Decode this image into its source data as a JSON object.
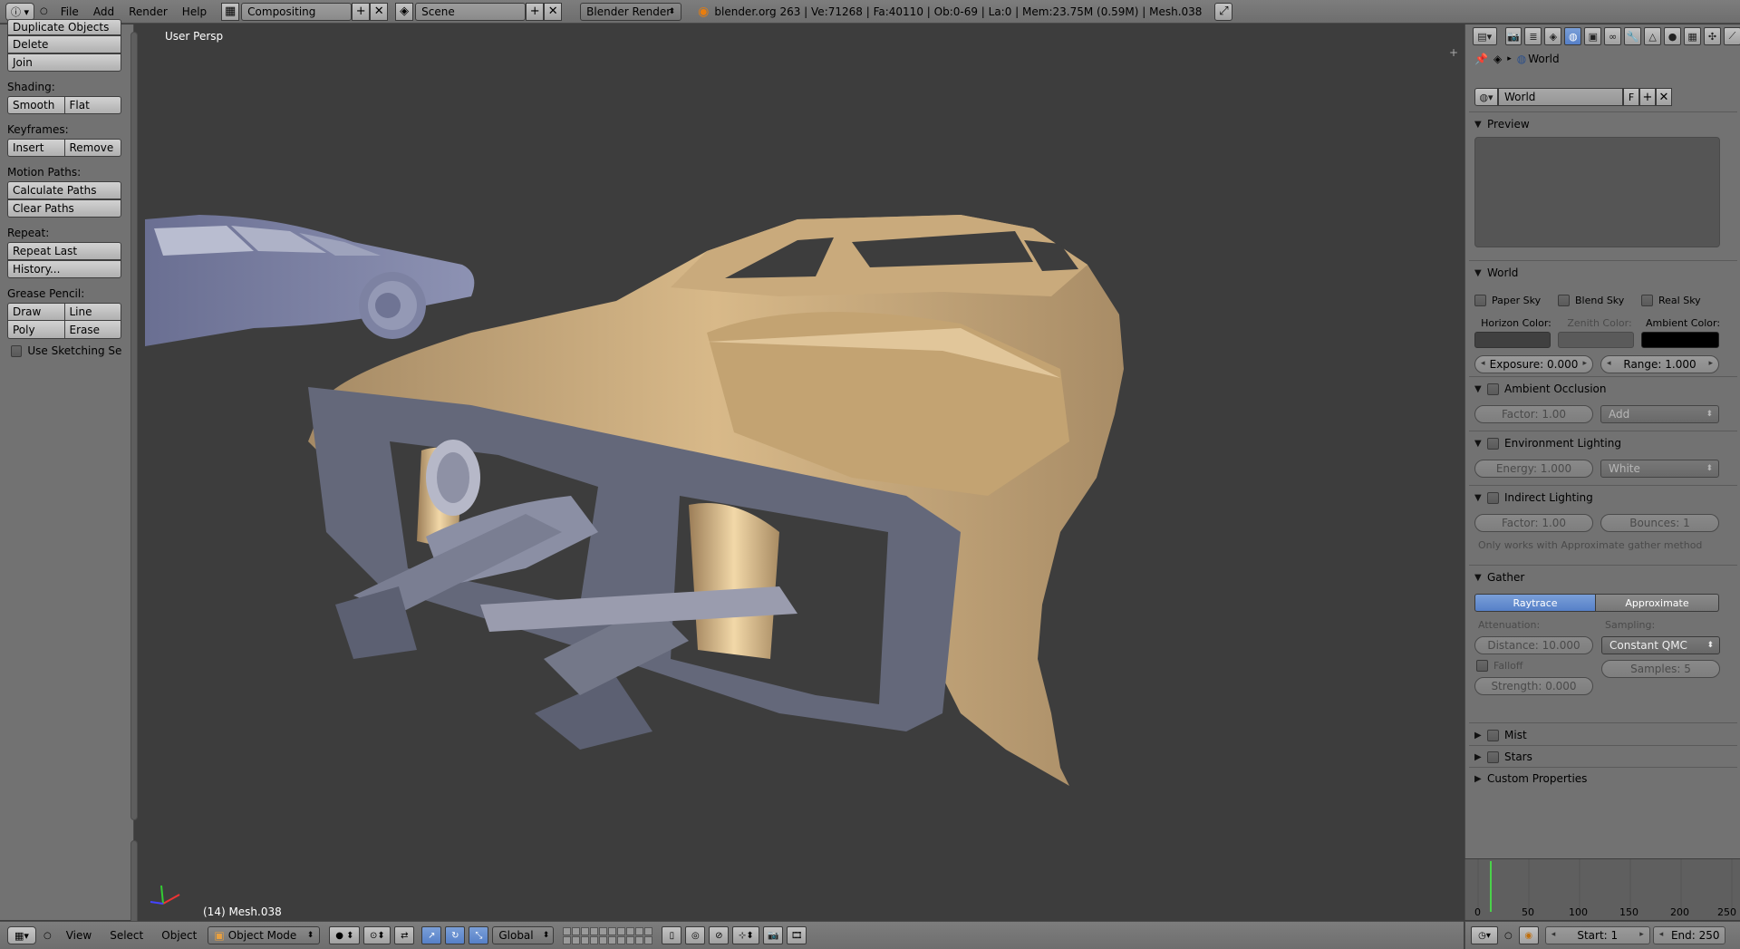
{
  "topbar": {
    "menus": [
      "File",
      "Add",
      "Render",
      "Help"
    ],
    "layout": "Compositing",
    "scene": "Scene",
    "engine": "Blender Render",
    "stats": "blender.org 263 | Ve:71268 | Fa:40110 | Ob:0-69 | La:0 | Mem:23.75M (0.59M) | Mesh.038"
  },
  "left_panel": {
    "dup_label": "Duplicate Objects",
    "delete": "Delete",
    "join": "Join",
    "shading_label": "Shading:",
    "smooth": "Smooth",
    "flat": "Flat",
    "keyframes_label": "Keyframes:",
    "insert": "Insert",
    "remove": "Remove",
    "motion_label": "Motion Paths:",
    "calc_paths": "Calculate Paths",
    "clear_paths": "Clear Paths",
    "repeat_label": "Repeat:",
    "repeat_last": "Repeat Last",
    "history": "History...",
    "grease_label": "Grease Pencil:",
    "draw": "Draw",
    "line": "Line",
    "poly": "Poly",
    "erase": "Erase",
    "sketching": "Use Sketching Sessio"
  },
  "viewport": {
    "persp": "User Persp",
    "object": "(14) Mesh.038"
  },
  "properties": {
    "breadcrumb": "World",
    "world_name": "World",
    "fake_user": "F",
    "preview_title": "Preview",
    "world_title": "World",
    "paper_sky": "Paper Sky",
    "blend_sky": "Blend Sky",
    "real_sky": "Real Sky",
    "horizon": "Horizon Color:",
    "zenith": "Zenith Color:",
    "ambient": "Ambient Color:",
    "exposure": "Exposure: 0.000",
    "range": "Range: 1.000",
    "ao_title": "Ambient Occlusion",
    "ao_factor": "Factor: 1.00",
    "ao_blend": "Add",
    "env_title": "Environment Lighting",
    "env_energy": "Energy: 1.000",
    "env_color": "White",
    "indirect_title": "Indirect Lighting",
    "ind_factor": "Factor: 1.00",
    "ind_bounces": "Bounces: 1",
    "ind_note": "Only works with Approximate gather method",
    "gather_title": "Gather",
    "raytrace": "Raytrace",
    "approximate": "Approximate",
    "attenuation": "Attenuation:",
    "sampling": "Sampling:",
    "distance": "Distance: 10.000",
    "qmc": "Constant QMC",
    "falloff": "Falloff",
    "samples": "Samples: 5",
    "strength": "Strength: 0.000",
    "mist": "Mist",
    "stars": "Stars",
    "custom": "Custom Properties"
  },
  "bottom": {
    "view": "View",
    "select": "Select",
    "object": "Object",
    "mode": "Object Mode",
    "orientation": "Global"
  },
  "timeline": {
    "ticks": [
      "0",
      "50",
      "100",
      "150",
      "200",
      "250"
    ],
    "start": "Start: 1",
    "end": "End: 250"
  },
  "colors": {
    "accent": "#5680c8",
    "car_body": "#c8a678",
    "frame": "#666a7a",
    "ambient_swatch": "#000000"
  }
}
